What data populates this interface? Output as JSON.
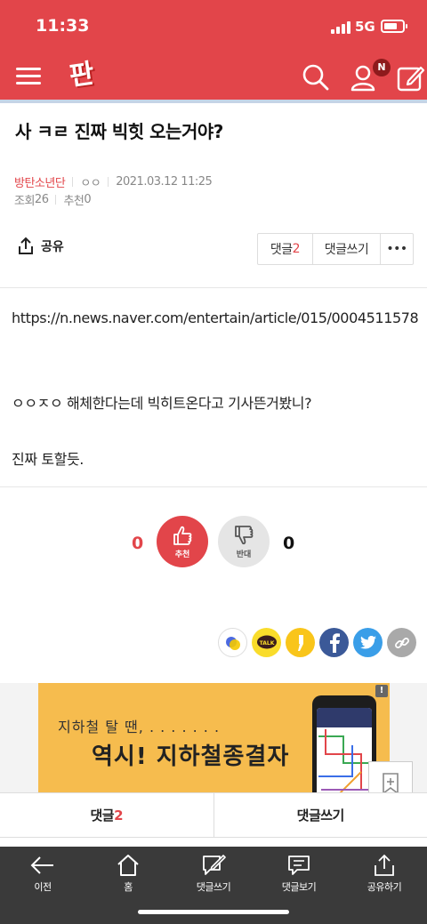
{
  "status": {
    "time": "11:33",
    "network": "5G"
  },
  "header": {
    "logo": "판",
    "notification_badge": "N"
  },
  "post": {
    "title": "사 ㅋㄹ 진짜 빅힛 오는거야?",
    "board": "방탄소년단",
    "author": "ㅇㅇ",
    "datetime": "2021.03.12 11:25",
    "views_label": "조회",
    "views": "26",
    "recommend_label": "추천",
    "recommend": "0"
  },
  "actions": {
    "share": "공유",
    "comment_label": "댓글",
    "comment_count": "2",
    "write_comment": "댓글쓰기",
    "more": "•••"
  },
  "body": {
    "url": "https://n.news.naver.com/entertain/article/015/0004511578",
    "line1": "ㅇㅇㅈㅇ 해체한다는데 빅히트온다고 기사뜬거봤니?",
    "line2": "진짜 토할듯."
  },
  "votes": {
    "up_count": "0",
    "up_label": "추천",
    "down_label": "반대",
    "down_count": "0"
  },
  "ad": {
    "line1": "지하철 탈 땐, . . . . . . .",
    "line2": "역시! 지하철종결자",
    "info": "!"
  },
  "comment_bar": {
    "comments_label": "댓글",
    "comments_count": "2",
    "write_label": "댓글쓰기"
  },
  "toolbar": {
    "back": "이전",
    "home": "홈",
    "write": "댓글쓰기",
    "view": "댓글보기",
    "share": "공유하기"
  },
  "colors": {
    "brand": "#e2454a",
    "toolbar": "#3a3a3a",
    "ad": "#f6bc4e"
  }
}
